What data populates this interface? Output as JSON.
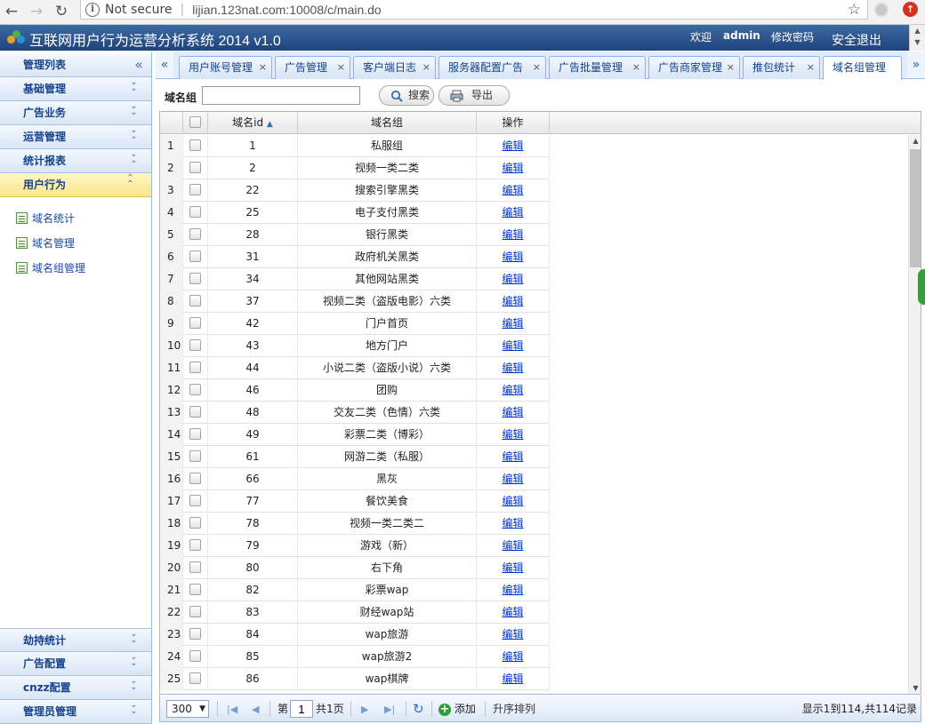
{
  "browser": {
    "security_label": "Not secure",
    "url": "lijian.123nat.com:10008/c/main.do"
  },
  "header": {
    "title": "互联网用户行为运营分析系统 2014 v1.0",
    "welcome": "欢迎",
    "username": "admin",
    "change_password": "修改密码",
    "logout": "安全退出"
  },
  "sidebar": {
    "top_label": "管理列表",
    "sections": [
      "基础管理",
      "广告业务",
      "运营管理",
      "统计报表",
      "用户行为"
    ],
    "active_section": "用户行为",
    "sub_items": [
      "域名统计",
      "域名管理",
      "域名组管理"
    ],
    "bottom_sections": [
      "劫持统计",
      "广告配置",
      "cnzz配置",
      "管理员管理"
    ]
  },
  "tabs": [
    "用户账号管理",
    "广告管理",
    "客户端日志",
    "服务器配置广告",
    "广告批量管理",
    "广告商家管理",
    "推包统计",
    "域名组管理"
  ],
  "active_tab": "域名组管理",
  "toolbar": {
    "label": "域名组",
    "input_value": "",
    "search_label": "搜索",
    "export_label": "导出"
  },
  "grid": {
    "columns": [
      "域名id",
      "域名组",
      "操作"
    ],
    "sort_column": "域名id",
    "sort_direction": "asc",
    "rows": [
      {
        "n": "1",
        "id": "1",
        "group": "私服组",
        "op": "编辑"
      },
      {
        "n": "2",
        "id": "2",
        "group": "视频一类二类",
        "op": "编辑"
      },
      {
        "n": "3",
        "id": "22",
        "group": "搜索引擎黑类",
        "op": "编辑"
      },
      {
        "n": "4",
        "id": "25",
        "group": "电子支付黑类",
        "op": "编辑"
      },
      {
        "n": "5",
        "id": "28",
        "group": "银行黑类",
        "op": "编辑"
      },
      {
        "n": "6",
        "id": "31",
        "group": "政府机关黑类",
        "op": "编辑"
      },
      {
        "n": "7",
        "id": "34",
        "group": "其他网站黑类",
        "op": "编辑"
      },
      {
        "n": "8",
        "id": "37",
        "group": "视频二类（盗版电影）六类",
        "op": "编辑"
      },
      {
        "n": "9",
        "id": "42",
        "group": "门户首页",
        "op": "编辑"
      },
      {
        "n": "10",
        "id": "43",
        "group": "地方门户",
        "op": "编辑"
      },
      {
        "n": "11",
        "id": "44",
        "group": "小说二类（盗版小说）六类",
        "op": "编辑"
      },
      {
        "n": "12",
        "id": "46",
        "group": "团购",
        "op": "编辑"
      },
      {
        "n": "13",
        "id": "48",
        "group": "交友二类（色情）六类",
        "op": "编辑"
      },
      {
        "n": "14",
        "id": "49",
        "group": "彩票二类（博彩）",
        "op": "编辑"
      },
      {
        "n": "15",
        "id": "61",
        "group": "网游二类（私服）",
        "op": "编辑"
      },
      {
        "n": "16",
        "id": "66",
        "group": "黑灰",
        "op": "编辑"
      },
      {
        "n": "17",
        "id": "77",
        "group": "餐饮美食",
        "op": "编辑"
      },
      {
        "n": "18",
        "id": "78",
        "group": "视频一类二类二",
        "op": "编辑"
      },
      {
        "n": "19",
        "id": "79",
        "group": "游戏（新）",
        "op": "编辑"
      },
      {
        "n": "20",
        "id": "80",
        "group": "右下角",
        "op": "编辑"
      },
      {
        "n": "21",
        "id": "82",
        "group": "彩票wap",
        "op": "编辑"
      },
      {
        "n": "22",
        "id": "83",
        "group": "财经wap站",
        "op": "编辑"
      },
      {
        "n": "23",
        "id": "84",
        "group": "wap旅游",
        "op": "编辑"
      },
      {
        "n": "24",
        "id": "85",
        "group": "wap旅游2",
        "op": "编辑"
      },
      {
        "n": "25",
        "id": "86",
        "group": "wap棋牌",
        "op": "编辑"
      }
    ]
  },
  "pager": {
    "page_size": "300",
    "page_prefix": "第",
    "page_number": "1",
    "page_suffix": "共1页",
    "add_label": "添加",
    "sort_label": "升序排列",
    "summary": "显示1到114,共114记录"
  },
  "colors": {
    "header_bg": "#2a4f8a",
    "active_section_bg": "#fce68b",
    "link": "#0033cc"
  }
}
